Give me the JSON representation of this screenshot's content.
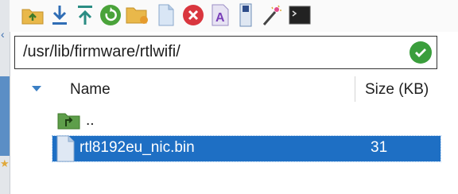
{
  "toolbar": {
    "buttons": [
      {
        "name": "parent-folder-button",
        "icon": "folder-up-icon"
      },
      {
        "name": "download-button",
        "icon": "download-arrow-icon"
      },
      {
        "name": "upload-button",
        "icon": "upload-arrow-icon"
      },
      {
        "name": "refresh-button",
        "icon": "refresh-icon"
      },
      {
        "name": "new-folder-button",
        "icon": "new-folder-icon"
      },
      {
        "name": "new-file-button",
        "icon": "new-file-icon"
      },
      {
        "name": "delete-button",
        "icon": "delete-icon"
      },
      {
        "name": "rename-button",
        "icon": "rename-icon"
      },
      {
        "name": "properties-button",
        "icon": "properties-icon"
      },
      {
        "name": "open-button",
        "icon": "magic-wand-icon"
      },
      {
        "name": "terminal-button",
        "icon": "terminal-icon"
      }
    ]
  },
  "path": {
    "value": "/usr/lib/firmware/rtlwifi/"
  },
  "list": {
    "columns": {
      "name": "Name",
      "size": "Size (KB)"
    },
    "parent_label": "..",
    "files": [
      {
        "name": "rtl8192eu_nic.bin",
        "size": "31",
        "selected": true
      }
    ]
  },
  "colors": {
    "selection": "#1e6fc4",
    "ok": "#3a9e3c",
    "delete": "#d9363e",
    "folder": "#5e9e4a"
  }
}
